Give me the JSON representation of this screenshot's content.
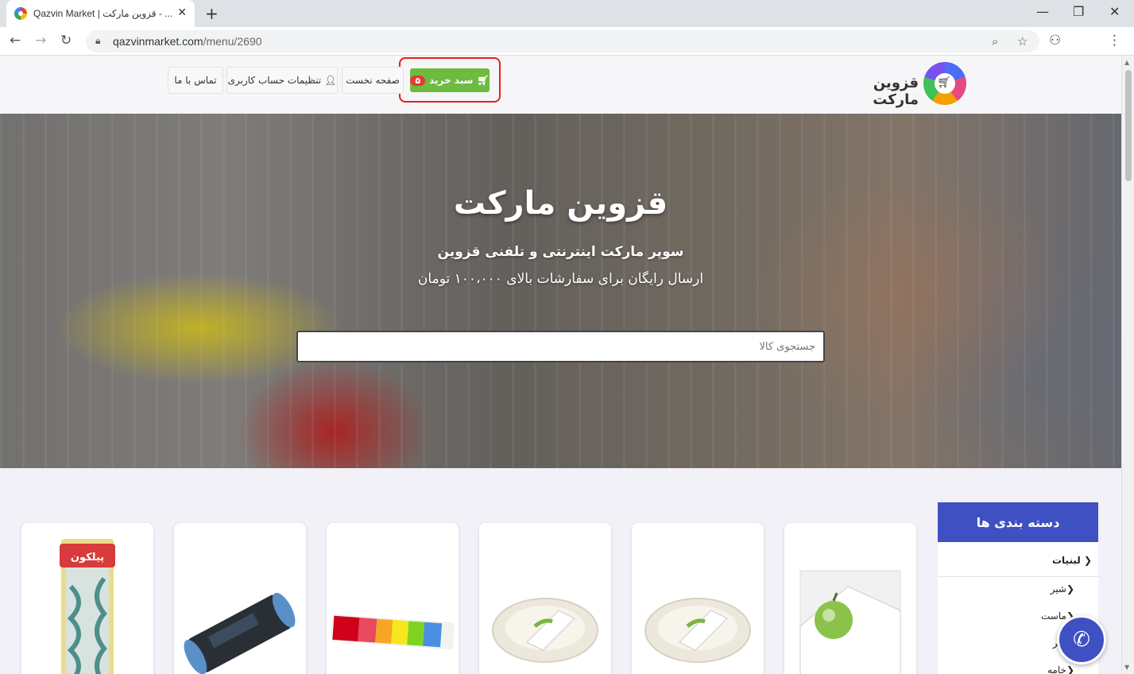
{
  "browser": {
    "tab_title": "Qazvin Market | قزوین مارکت - ...",
    "tab_close": "✕",
    "new_tab": "+",
    "url_host": "qazvinmarket.com",
    "url_path": "/menu/2690",
    "minimize": "—",
    "maximize": "❐",
    "close": "✕"
  },
  "header": {
    "logo_text": "قزوین مارکت",
    "cart_label": "سبد خرید",
    "cart_count": "۵",
    "nav_home": "صفحه نخست",
    "nav_account": "تنظیمات حساب کاربری",
    "nav_contact": "تماس با ما"
  },
  "hero": {
    "title": "قزوین مارکت",
    "subtitle": "سوپر مارکت اینترنتی و تلفنی قزوین",
    "shipping_note": "ارسال رایگان برای سفارشات بالای ۱۰۰،۰۰۰ تومان",
    "search_placeholder": "جستجوی کالا"
  },
  "categories": {
    "title": "دسته بندی ها",
    "items": [
      {
        "label": "لبنیات"
      },
      {
        "label": "شیر"
      },
      {
        "label": "ماست"
      },
      {
        "label": "پنیر"
      },
      {
        "label": "خامه"
      }
    ]
  },
  "products": [
    {
      "name": "kitchen-towel",
      "color": "#e8c93c"
    },
    {
      "name": "garbage-bags",
      "color": "#3b5f8a"
    },
    {
      "name": "candy-pack",
      "color": "#e04a5a"
    },
    {
      "name": "disposable-bowl",
      "color": "#e9e6dc"
    },
    {
      "name": "disposable-bowl",
      "color": "#e9e6dc"
    },
    {
      "name": "disposable-plate",
      "color": "#7cb342"
    }
  ],
  "colors": {
    "accent": "#3f51c2",
    "cart_green": "#6dbb3f",
    "badge_red": "#e53935",
    "highlight_red": "#e52020"
  }
}
